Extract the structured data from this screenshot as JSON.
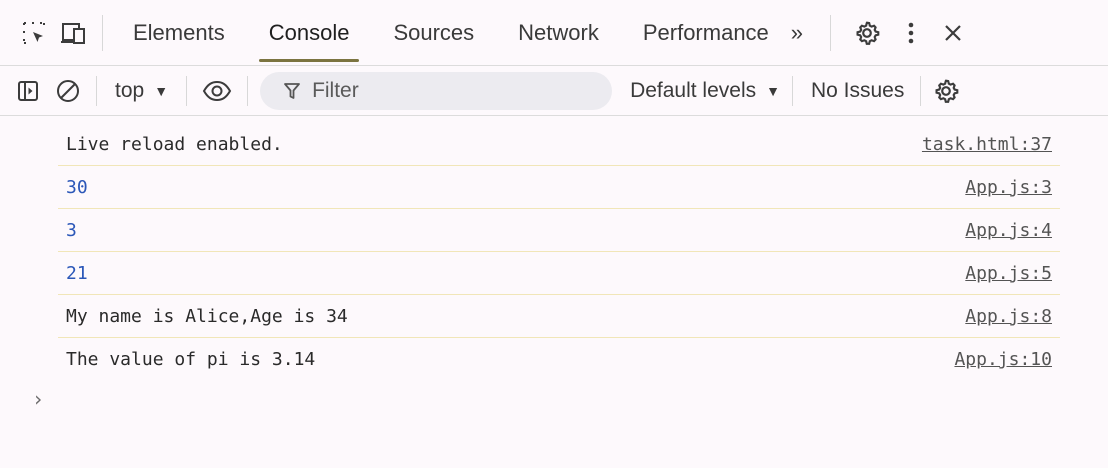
{
  "tabs": [
    {
      "label": "Elements"
    },
    {
      "label": "Console"
    },
    {
      "label": "Sources"
    },
    {
      "label": "Network"
    },
    {
      "label": "Performance"
    }
  ],
  "active_tab": "Console",
  "more_tabs": "»",
  "toolbar": {
    "context": "top",
    "filter_placeholder": "Filter",
    "levels": "Default levels",
    "issues": "No Issues"
  },
  "console": [
    {
      "text": "Live reload enabled.",
      "source": "task.html:37",
      "type": "log"
    },
    {
      "text": "30",
      "source": "App.js:3",
      "type": "number"
    },
    {
      "text": "3",
      "source": "App.js:4",
      "type": "number"
    },
    {
      "text": "21",
      "source": "App.js:5",
      "type": "number"
    },
    {
      "text": "My name is Alice,Age is 34",
      "source": "App.js:8",
      "type": "log"
    },
    {
      "text": "The value of pi is 3.14",
      "source": "App.js:10",
      "type": "log"
    }
  ],
  "prompt_symbol": "›",
  "colors": {
    "background": "#fdf9fc",
    "active_tab_underline": "#7b7440",
    "number_value": "#2b57b8",
    "row_divider": "#f1e6b8"
  }
}
